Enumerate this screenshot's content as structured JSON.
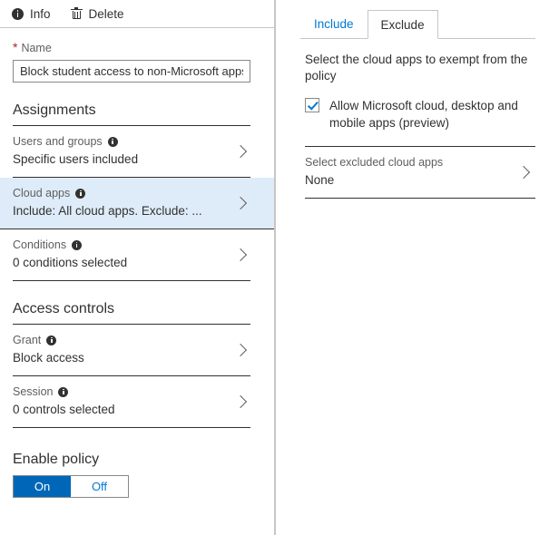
{
  "left_pane": {
    "command_bar": {
      "info_label": "Info",
      "delete_label": "Delete"
    },
    "name_field": {
      "label": "Name",
      "required_marker": "*",
      "value": "Block student access to non-Microsoft apps",
      "placeholder": ""
    },
    "assignments": {
      "title": "Assignments",
      "rows": [
        {
          "label": "Users and groups",
          "value": "Specific users included",
          "selected": false
        },
        {
          "label": "Cloud apps",
          "value": "Include: All cloud apps. Exclude: ...",
          "selected": true
        },
        {
          "label": "Conditions",
          "value": "0 conditions selected",
          "selected": false
        }
      ]
    },
    "access_controls": {
      "title": "Access controls",
      "rows": [
        {
          "label": "Grant",
          "value": "Block access",
          "selected": false
        },
        {
          "label": "Session",
          "value": "0 controls selected",
          "selected": false
        }
      ]
    },
    "enable_policy": {
      "title": "Enable policy",
      "on_label": "On",
      "off_label": "Off",
      "state": "On"
    }
  },
  "right_pane": {
    "tabs": [
      {
        "label": "Include",
        "active": false
      },
      {
        "label": "Exclude",
        "active": true
      }
    ],
    "description": "Select the cloud apps to exempt from the policy",
    "checkbox": {
      "label": "Allow Microsoft cloud, desktop and mobile apps (preview)",
      "checked": true
    },
    "excluded_apps_row": {
      "label": "Select excluded cloud apps",
      "value": "None"
    }
  },
  "colors": {
    "accent": "#0078d4",
    "toggle_on_bg": "#0067b8",
    "selected_row_bg": "#deecf9",
    "required_star": "#a4262c",
    "text_primary": "#323130",
    "text_secondary": "#605e5c",
    "border": "#c8c6c4"
  }
}
